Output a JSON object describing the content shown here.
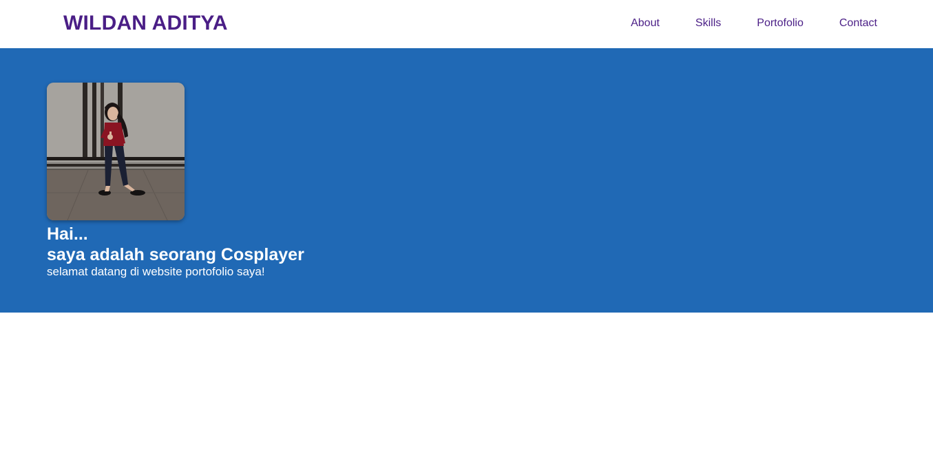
{
  "navbar": {
    "brand": "WILDAN ADITYA",
    "links": [
      {
        "label": "About"
      },
      {
        "label": "Skills"
      },
      {
        "label": "Portofolio"
      },
      {
        "label": "Contact"
      }
    ]
  },
  "hero": {
    "greeting": "Hai...",
    "headline": "saya adalah seorang Cosplayer",
    "subtext": "selamat datang di website portofolio saya!"
  },
  "colors": {
    "brand_purple": "#4a1e86",
    "hero_blue": "#2069b5",
    "text_white": "#ffffff"
  }
}
